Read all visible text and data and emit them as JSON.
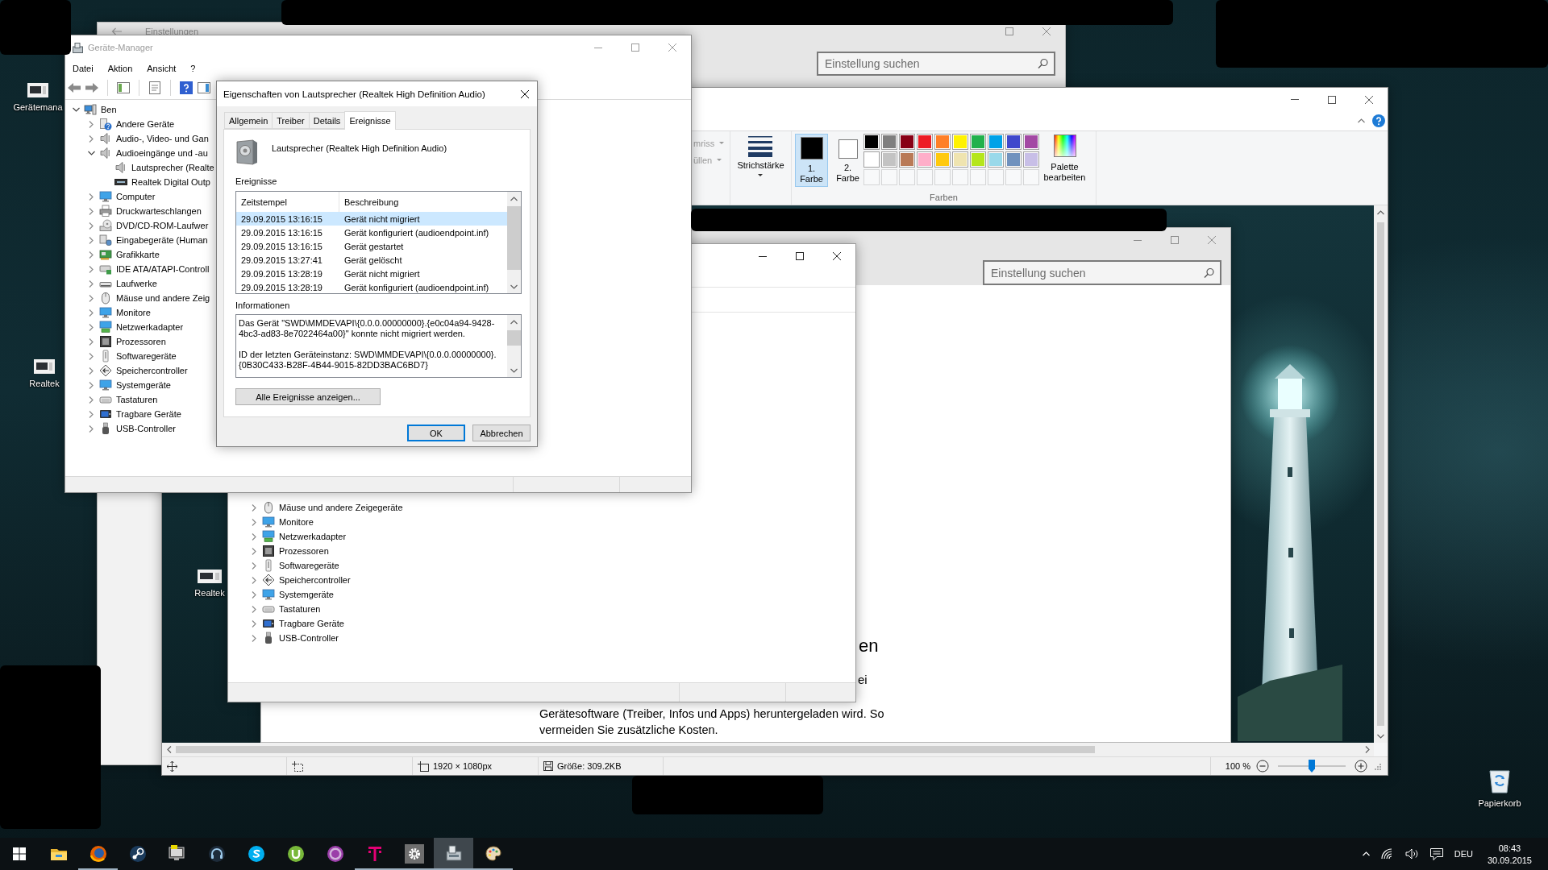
{
  "desktop": {
    "icons": [
      {
        "kind": "device",
        "label": "Gerätemana"
      },
      {
        "kind": "device",
        "label": "Realtek"
      },
      {
        "kind": "recycle-bin",
        "label": "Papierkorb"
      }
    ]
  },
  "settings_window": {
    "title": "Einstellungen",
    "search": {
      "placeholder": "Einstellung suchen"
    }
  },
  "paint": {
    "ribbon": {
      "shape_options": [
        {
          "label": "mriss",
          "disabled": true
        },
        {
          "label": "üllen",
          "disabled": true
        }
      ],
      "stroke_size": {
        "label": "Strichstärke"
      },
      "color_slots": [
        {
          "label": "1. Farbe",
          "color": "#000000",
          "selected": true
        },
        {
          "label": "2. Farbe",
          "color": "#ffffff",
          "selected": false
        }
      ],
      "palette": [
        {
          "kind": "swatch",
          "color": "#000000"
        },
        {
          "kind": "swatch",
          "color": "#7f7f7f"
        },
        {
          "kind": "swatch",
          "color": "#880015"
        },
        {
          "kind": "swatch",
          "color": "#ed1c24"
        },
        {
          "kind": "swatch",
          "color": "#ff7f27"
        },
        {
          "kind": "swatch",
          "color": "#fff200"
        },
        {
          "kind": "swatch",
          "color": "#22b14c"
        },
        {
          "kind": "swatch",
          "color": "#00a2e8"
        },
        {
          "kind": "swatch",
          "color": "#3f48cc"
        },
        {
          "kind": "swatch",
          "color": "#a349a4"
        },
        {
          "kind": "swatch",
          "color": "#ffffff"
        },
        {
          "kind": "swatch",
          "color": "#c3c3c3"
        },
        {
          "kind": "swatch",
          "color": "#b97a57"
        },
        {
          "kind": "swatch",
          "color": "#ffaec9"
        },
        {
          "kind": "swatch",
          "color": "#ffc90e"
        },
        {
          "kind": "swatch",
          "color": "#efe4b0"
        },
        {
          "kind": "swatch",
          "color": "#b5e61d"
        },
        {
          "kind": "swatch",
          "color": "#99d9ea"
        },
        {
          "kind": "swatch",
          "color": "#7092be"
        },
        {
          "kind": "swatch",
          "color": "#c8bfe7"
        },
        {
          "kind": "empty"
        },
        {
          "kind": "empty"
        },
        {
          "kind": "empty"
        },
        {
          "kind": "empty"
        },
        {
          "kind": "empty"
        },
        {
          "kind": "empty"
        },
        {
          "kind": "empty"
        },
        {
          "kind": "empty"
        },
        {
          "kind": "empty"
        },
        {
          "kind": "empty"
        }
      ],
      "edit_colors": {
        "label": "Palette bearbeiten"
      },
      "group_label": "Farben"
    },
    "canvas": {
      "desktop_icons": [
        {
          "label": "Realtek"
        }
      ],
      "settings_window": {
        "search": {
          "placeholder": "Einstellung suchen"
        },
        "heading_fragment": "en",
        "text_fragment": "ei",
        "paragraph_lines": [
          "Gerätesoftware (Treiber, Infos und Apps) heruntergeladen wird. So",
          "vermeiden Sie zusätzliche Kosten."
        ]
      },
      "device_manager": {
        "items": [
          {
            "label": "Mäuse und andere Zeigegeräte",
            "kind": "mouse",
            "expanded": false
          },
          {
            "label": "Monitore",
            "kind": "monitor",
            "expanded": false
          },
          {
            "label": "Netzwerkadapter",
            "kind": "network",
            "expanded": false
          },
          {
            "label": "Prozessoren",
            "kind": "processor",
            "expanded": false
          },
          {
            "label": "Softwaregeräte",
            "kind": "software-device",
            "expanded": false
          },
          {
            "label": "Speichercontroller",
            "kind": "storage-controller",
            "expanded": false
          },
          {
            "label": "Systemgeräte",
            "kind": "monitor",
            "expanded": false
          },
          {
            "label": "Tastaturen",
            "kind": "keyboard",
            "expanded": false
          },
          {
            "label": "Tragbare Geräte",
            "kind": "portable-device",
            "expanded": false
          },
          {
            "label": "USB-Controller",
            "kind": "usb",
            "expanded": false
          }
        ]
      }
    },
    "status_bar": {
      "dimensions": "1920 × 1080px",
      "file_size": "Größe: 309.2KB",
      "zoom": {
        "reading": "100 %",
        "level": 0.5
      }
    }
  },
  "device_manager": {
    "title": "Geräte-Manager",
    "menu": [
      "Datei",
      "Aktion",
      "Ansicht",
      "?"
    ],
    "tree": [
      {
        "label": "Ben",
        "kind": "computer",
        "expanded": true,
        "children": [
          {
            "label": "Andere Geräte",
            "kind": "unknown-device",
            "expanded": false
          },
          {
            "label": "Audio-, Video- und Gan",
            "kind": "speaker",
            "expanded": false
          },
          {
            "label": "Audioeingänge und -au",
            "kind": "speaker",
            "expanded": true,
            "children": [
              {
                "label": "Lautsprecher (Realte",
                "kind": "speaker"
              },
              {
                "label": "Realtek Digital Outp",
                "kind": "audio-port"
              }
            ]
          },
          {
            "label": "Computer",
            "kind": "monitor",
            "expanded": false
          },
          {
            "label": "Druckwarteschlangen",
            "kind": "printer",
            "expanded": false
          },
          {
            "label": "DVD/CD-ROM-Laufwer",
            "kind": "disc-drive",
            "expanded": false
          },
          {
            "label": "Eingabegeräte (Human",
            "kind": "input-device",
            "expanded": false
          },
          {
            "label": "Grafikkarte",
            "kind": "graphics-card",
            "expanded": false
          },
          {
            "label": "IDE ATA/ATAPI-Controll",
            "kind": "ide-controller",
            "expanded": false
          },
          {
            "label": "Laufwerke",
            "kind": "drive",
            "expanded": false
          },
          {
            "label": "Mäuse und andere Zeig",
            "kind": "mouse",
            "expanded": false
          },
          {
            "label": "Monitore",
            "kind": "monitor",
            "expanded": false
          },
          {
            "label": "Netzwerkadapter",
            "kind": "network",
            "expanded": false
          },
          {
            "label": "Prozessoren",
            "kind": "processor",
            "expanded": false
          },
          {
            "label": "Softwaregeräte",
            "kind": "software-device",
            "expanded": false
          },
          {
            "label": "Speichercontroller",
            "kind": "storage-controller",
            "expanded": false
          },
          {
            "label": "Systemgeräte",
            "kind": "monitor",
            "expanded": false
          },
          {
            "label": "Tastaturen",
            "kind": "keyboard",
            "expanded": false
          },
          {
            "label": "Tragbare Geräte",
            "kind": "portable-device",
            "expanded": false
          },
          {
            "label": "USB-Controller",
            "kind": "usb",
            "expanded": false
          }
        ]
      }
    ]
  },
  "properties_dialog": {
    "title": "Eigenschaften von Lautsprecher (Realtek High Definition Audio)",
    "tabs": [
      {
        "label": "Allgemein",
        "selected": false
      },
      {
        "label": "Treiber",
        "selected": false
      },
      {
        "label": "Details",
        "selected": false
      },
      {
        "label": "Ereignisse",
        "selected": true
      }
    ],
    "device_name": "Lautsprecher (Realtek High Definition Audio)",
    "events_label": "Ereignisse",
    "events": {
      "columns": [
        "Zeitstempel",
        "Beschreibung"
      ],
      "rows": [
        {
          "time": "29.09.2015 13:16:15",
          "description": "Gerät nicht migriert",
          "selected": true
        },
        {
          "time": "29.09.2015 13:16:15",
          "description": "Gerät konfiguriert (audioendpoint.inf)",
          "selected": false
        },
        {
          "time": "29.09.2015 13:16:15",
          "description": "Gerät gestartet",
          "selected": false
        },
        {
          "time": "29.09.2015 13:27:41",
          "description": "Gerät gelöscht",
          "selected": false
        },
        {
          "time": "29.09.2015 13:28:19",
          "description": "Gerät nicht migriert",
          "selected": false
        },
        {
          "time": "29.09.2015 13:28:19",
          "description": "Gerät konfiguriert (audioendpoint.inf)",
          "selected": false
        }
      ]
    },
    "info_label": "Informationen",
    "info_paragraphs": [
      [
        "Das Gerät \"SWD\\MMDEVAPI\\{0.0.0.00000000}.{e0c04a94-9428-",
        "4bc3-ad83-8e7022464a00}\" konnte nicht migriert werden."
      ],
      [
        "ID der letzten Geräteinstanz: SWD\\MMDEVAPI\\{0.0.0.00000000}.",
        "{0B30C433-B28F-4B44-9015-82DD3BAC6BD7}"
      ]
    ],
    "show_all_button": "Alle Ereignisse anzeigen...",
    "buttons": [
      {
        "label": "OK",
        "default": true
      },
      {
        "label": "Abbrechen",
        "default": false
      }
    ]
  },
  "taskbar": {
    "apps": [
      {
        "kind": "folder",
        "running": false,
        "active": false
      },
      {
        "kind": "fox-globe",
        "running": true,
        "active": false
      },
      {
        "kind": "piston",
        "running": false,
        "active": false
      },
      {
        "kind": "monitor",
        "running": false,
        "active": false
      },
      {
        "kind": "headset",
        "running": false,
        "active": false
      },
      {
        "kind": "chat",
        "running": false,
        "active": false
      },
      {
        "kind": "torrent",
        "running": false,
        "active": false
      },
      {
        "kind": "ring",
        "running": false,
        "active": false
      },
      {
        "kind": "t-logo",
        "running": true,
        "active": false
      },
      {
        "kind": "gear",
        "running": true,
        "active": false
      },
      {
        "kind": "computer",
        "running": true,
        "active": true
      },
      {
        "kind": "palette",
        "running": true,
        "active": false
      }
    ],
    "tray": {
      "language": "DEU",
      "time": "08:43",
      "date": "30.09.2015"
    }
  }
}
